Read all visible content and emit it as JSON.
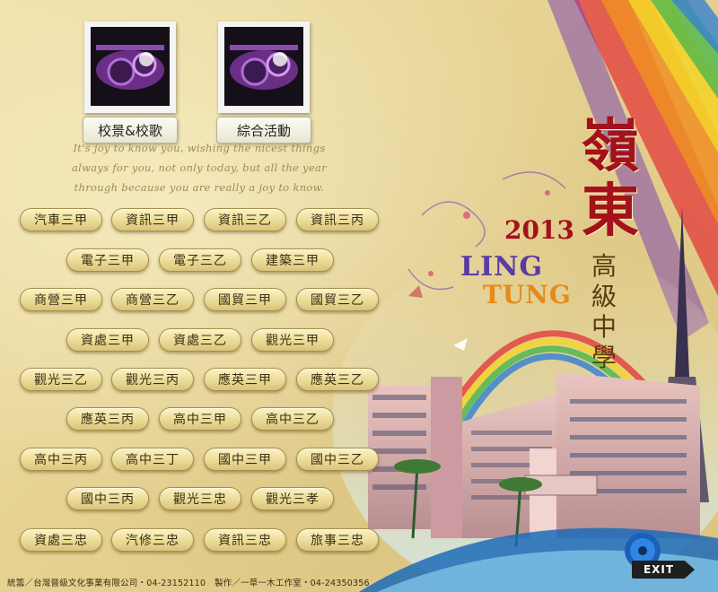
{
  "top_buttons": [
    {
      "label": "校景&校歌"
    },
    {
      "label": "綜合活動"
    }
  ],
  "quote": {
    "line1": "It's joy to know you, wishing the nicest things",
    "line2": "always for you, not only today, but all the year",
    "line3": "through because you are really a joy to know."
  },
  "classes": [
    "汽車三甲",
    "資訊三甲",
    "資訊三乙",
    "資訊三丙",
    "電子三甲",
    "電子三乙",
    "建築三甲",
    "商營三甲",
    "商營三乙",
    "國貿三甲",
    "國貿三乙",
    "資處三甲",
    "資處三乙",
    "觀光三甲",
    "觀光三乙",
    "觀光三丙",
    "應英三甲",
    "應英三乙",
    "應英三丙",
    "高中三甲",
    "高中三乙",
    "高中三丙",
    "高中三丁",
    "國中三甲",
    "國中三乙",
    "國中三丙",
    "觀光三忠",
    "觀光三孝",
    "資處三忠",
    "汽修三忠",
    "資訊三忠",
    "旅事三忠"
  ],
  "title": {
    "school_name_big": "嶺東",
    "school_type": [
      "高",
      "級",
      "中",
      "學"
    ],
    "year": "2013",
    "ling": "LING",
    "tung": "TUNG"
  },
  "footer": {
    "text": "統籌／台灣晉級文化事業有限公司・04-23152110　製作／一草一木工作室・04-24350356"
  },
  "exit": {
    "label": "EXIT"
  },
  "colors": {
    "title_red": "#a3121a",
    "parchment": "#e8d79e",
    "button_gold": "#efdf9e"
  }
}
